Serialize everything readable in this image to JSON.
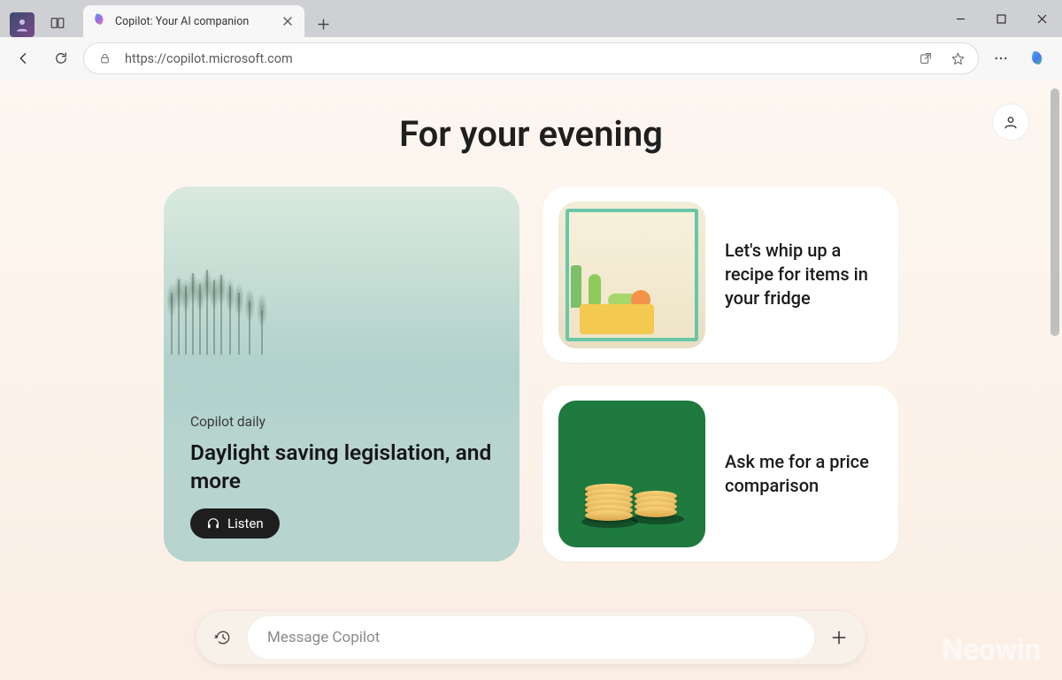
{
  "window": {
    "tab_title": "Copilot: Your AI companion"
  },
  "toolbar": {
    "url": "https://copilot.microsoft.com"
  },
  "page": {
    "title": "For your evening"
  },
  "main_card": {
    "eyebrow": "Copilot daily",
    "headline": "Daylight saving legislation, and more",
    "listen_label": "Listen"
  },
  "side_cards": [
    {
      "text": "Let's whip up a recipe for items in your fridge"
    },
    {
      "text": "Ask me for a price comparison"
    }
  ],
  "compose": {
    "placeholder": "Message Copilot"
  },
  "watermark": "Neowin"
}
